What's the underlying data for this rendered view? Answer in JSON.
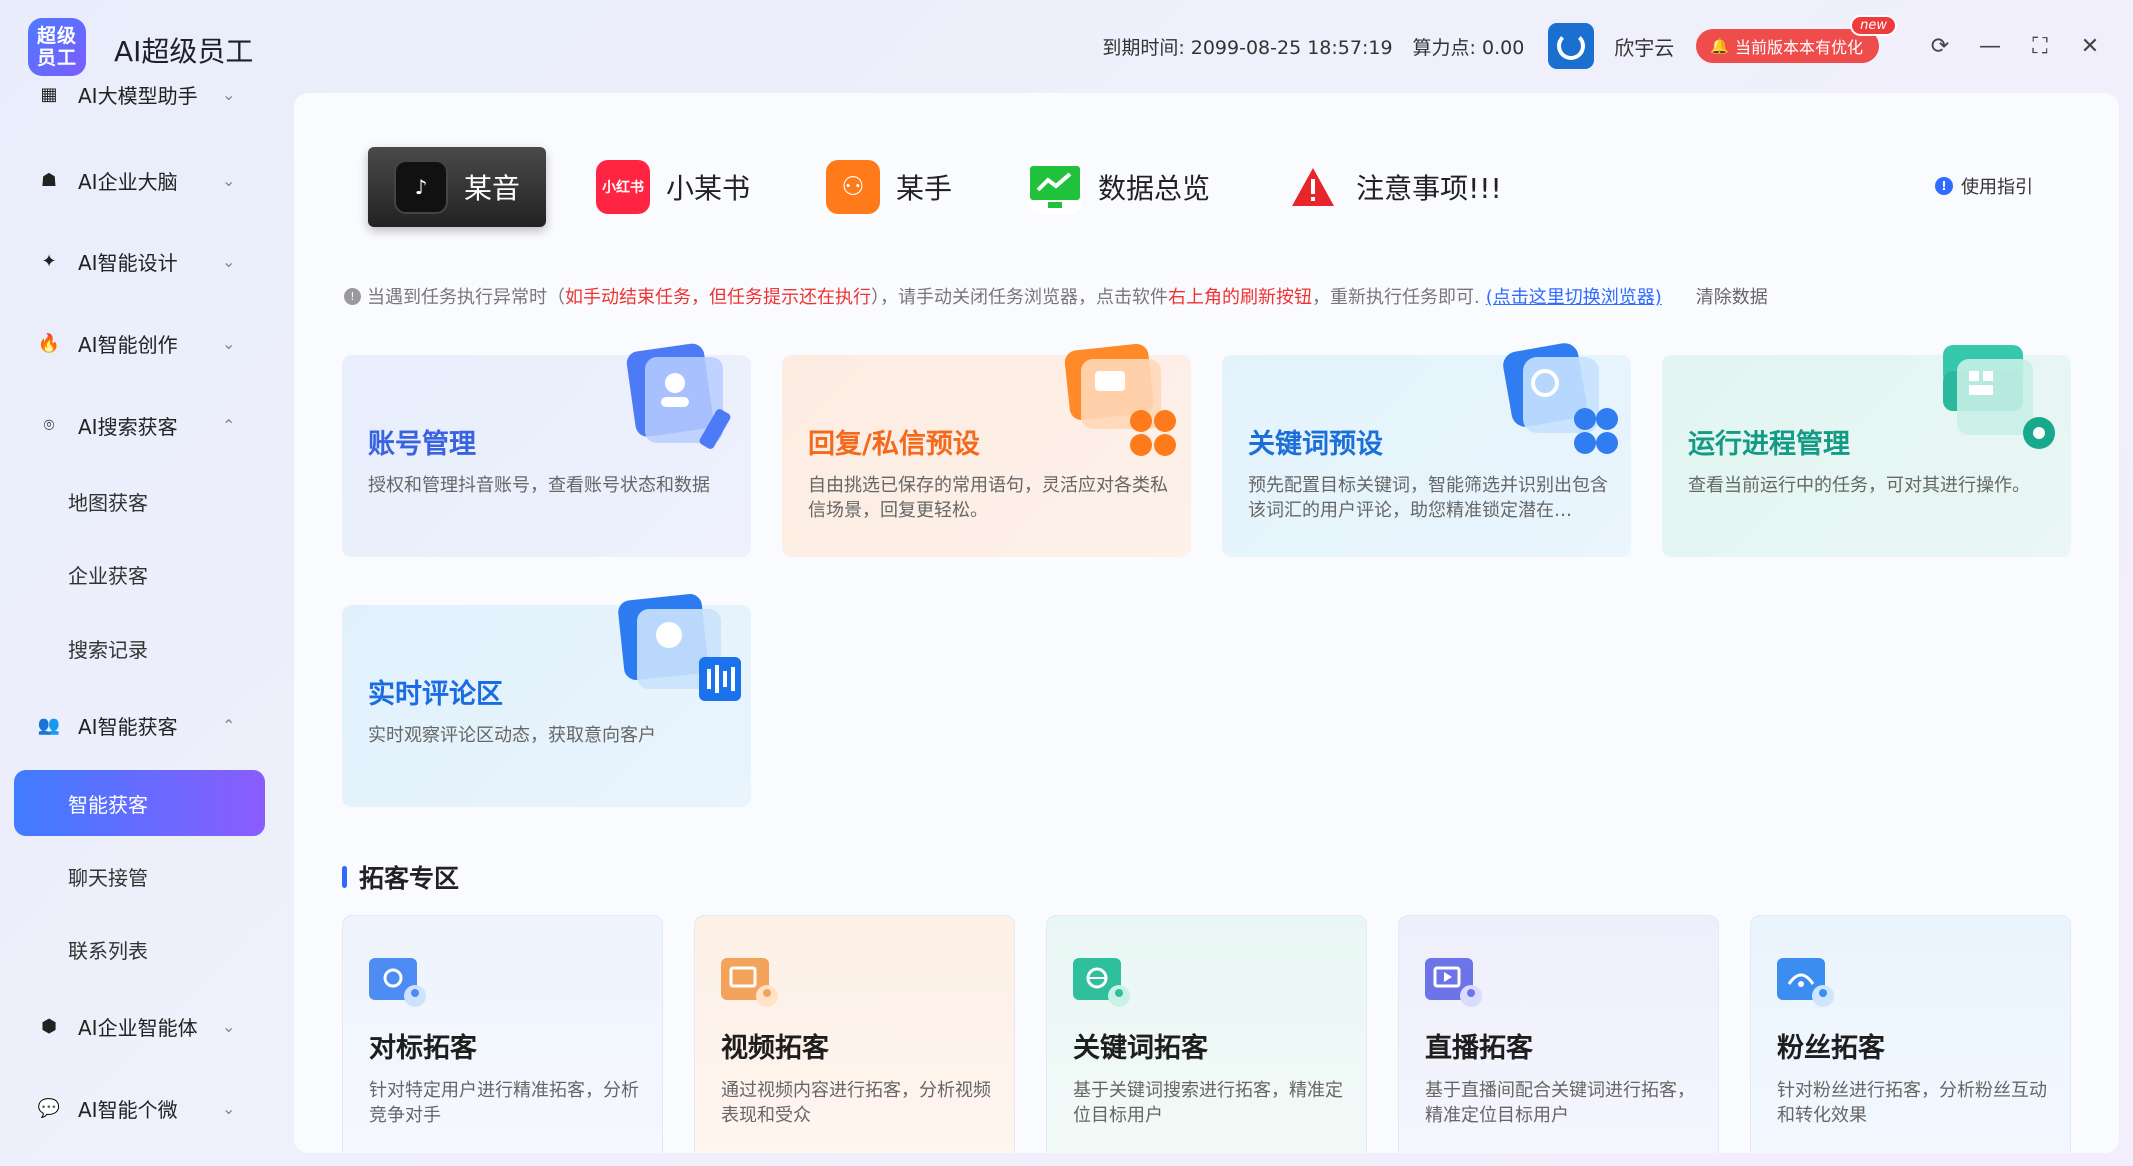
{
  "app": {
    "logo_text": "超级员工",
    "title": "AI超级员工"
  },
  "header": {
    "expire_label": "到期时间: 2099-08-25 18:57:19",
    "points_label": "算力点: 0.00",
    "user_name": "欣宇云",
    "update_label": "当前版本本有优化",
    "new_badge": "new"
  },
  "sidebar": {
    "groups": [
      {
        "label": "AI大模型助手"
      },
      {
        "label": "AI企业大脑"
      },
      {
        "label": "AI智能设计"
      },
      {
        "label": "AI智能创作"
      },
      {
        "label": "AI搜索获客"
      },
      {
        "label": "AI智能获客"
      },
      {
        "label": "AI企业智能体"
      },
      {
        "label": "AI智能个微"
      }
    ],
    "subs": [
      {
        "label": "地图获客"
      },
      {
        "label": "企业获客"
      },
      {
        "label": "搜索记录"
      },
      {
        "label": "智能获客"
      },
      {
        "label": "聊天接管"
      },
      {
        "label": "联系列表"
      }
    ]
  },
  "tabs": [
    {
      "label": "某音",
      "icon": "tiktok-icon"
    },
    {
      "label": "小某书",
      "icon": "redbook-icon",
      "icon_text": "小红书"
    },
    {
      "label": "某手",
      "icon": "kuaishou-icon"
    },
    {
      "label": "数据总览",
      "icon": "monitor-icon"
    },
    {
      "label": "注意事项!!!",
      "icon": "warning-icon"
    }
  ],
  "guide_label": "使用指引",
  "notice": {
    "part1": "当遇到任务执行异常时（",
    "red1": "如手动结束任务，但任务提示还在执行",
    "part2": "），请手动关闭任务浏览器，点击软件",
    "red2": "右上角的刷新按钮",
    "part3": "，重新执行任务即可.",
    "link": "(点击这里切换浏览器)",
    "clear": "清除数据"
  },
  "features": [
    {
      "title": "账号管理",
      "desc": "授权和管理抖音账号，查看账号状态和数据"
    },
    {
      "title": "回复/私信预设",
      "desc": "自由挑选已保存的常用语句，灵活应对各类私信场景，回复更轻松。"
    },
    {
      "title": "关键词预设",
      "desc": "预先配置目标关键词，智能筛选并识别出包含该词汇的用户评论，助您精准锁定潜在…"
    },
    {
      "title": "运行进程管理",
      "desc": "查看当前运行中的任务，可对其进行操作。"
    },
    {
      "title": "实时评论区",
      "desc": "实时观察评论区动态，获取意向客户"
    }
  ],
  "section_title": "拓客专区",
  "prospect": [
    {
      "title": "对标拓客",
      "desc": "针对特定用户进行精准拓客，分析竞争对手"
    },
    {
      "title": "视频拓客",
      "desc": "通过视频内容进行拓客，分析视频表现和受众"
    },
    {
      "title": "关键词拓客",
      "desc": "基于关键词搜索进行拓客，精准定位目标用户"
    },
    {
      "title": "直播拓客",
      "desc": "基于直播间配合关键词进行拓客，精准定位目标用户"
    },
    {
      "title": "粉丝拓客",
      "desc": "针对粉丝进行拓客，分析粉丝互动和转化效果"
    }
  ]
}
